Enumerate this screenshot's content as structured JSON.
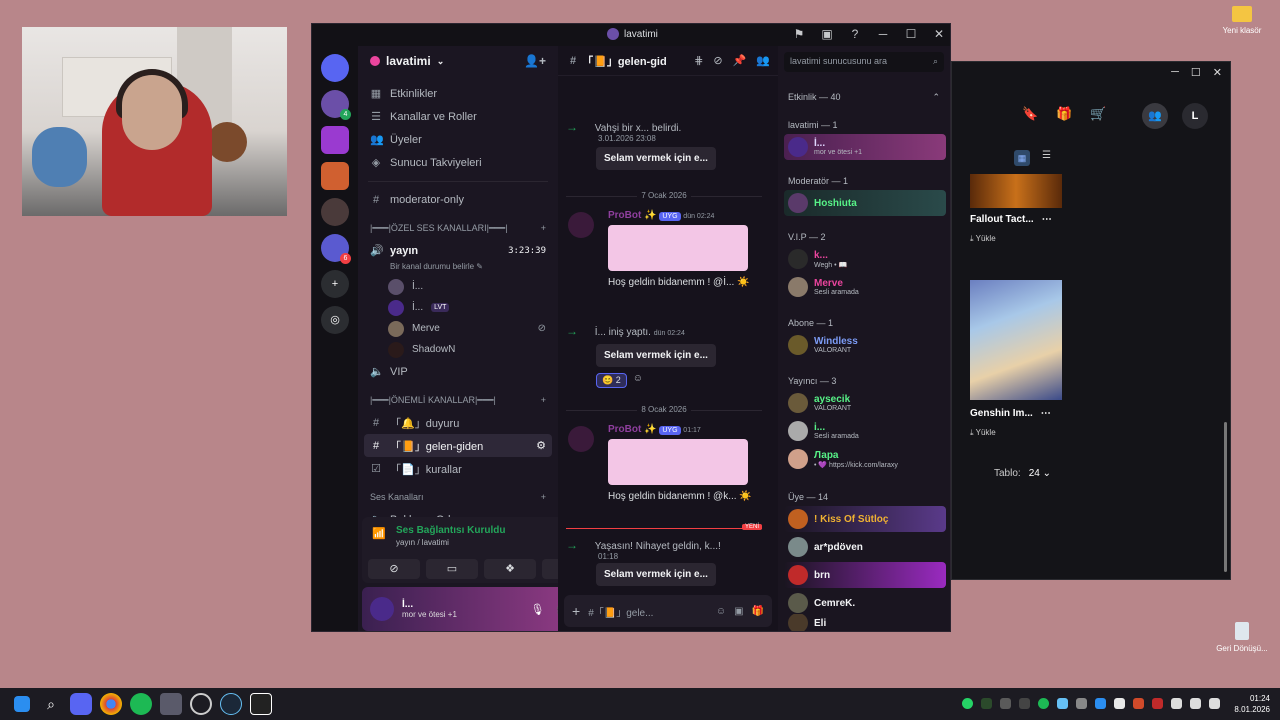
{
  "desktop": {
    "folder_label": "Yeni klasör",
    "recycle_label": "Geri Dönüşü..."
  },
  "discord": {
    "window_title": "lavatimi",
    "guild_name": "lavatimi",
    "nav": [
      {
        "icon": "calendar-icon",
        "label": "Etkinlikler"
      },
      {
        "icon": "channels-roles-icon",
        "label": "Kanallar ve Roller"
      },
      {
        "icon": "members-icon",
        "label": "Üyeler"
      },
      {
        "icon": "boost-icon",
        "label": "Sunucu Takviyeleri"
      }
    ],
    "moderator_channel": "moderator-only",
    "voice_category": "|━━━|ÖZEL SES KANALLARI|━━━|",
    "voice_channel": "yayın",
    "voice_timer": "3:23:39",
    "voice_status": "Bir kanal durumu belirle",
    "voice_users": [
      {
        "name": "İ..."
      },
      {
        "name": "İ...",
        "tag": "LVT"
      },
      {
        "name": "Merve"
      },
      {
        "name": "ShadowN"
      }
    ],
    "vip_channel": "VIP",
    "important_category": "|━━━|ÖNEMLİ KANALLAR|━━━|",
    "text_channels": [
      {
        "label": "「🔔」duyuru",
        "selected": false
      },
      {
        "label": "「📙」gelen-giden",
        "selected": true
      },
      {
        "label": "「📄」kurallar",
        "selected": false
      }
    ],
    "voice_channels_cat": "Ses Kanalları",
    "waiting_room": "Bekleme Odası",
    "voice_panel": {
      "title": "Ses Bağlantısı Kuruldu",
      "sub": "yayın / lavatimi"
    },
    "user_panel": {
      "name": "İ...",
      "status": "mor ve ötesi +1"
    },
    "chat": {
      "channel": "「📙」gelen-gid",
      "msg1": {
        "text": "Vahşi bir x... belirdi.",
        "time": "3.01.2026 23:08",
        "btn": "Selam vermek için e..."
      },
      "date1": "7 Ocak 2026",
      "bot_name": "ProBot ✨",
      "bot_tag": "UYG",
      "bot_time1": "dün 02:24",
      "welcome1": "Hoş geldin bidanemm ! @İ... ☀️",
      "msg2": {
        "text": "İ... iniş yaptı.",
        "time": "dün 02:24",
        "btn": "Selam vermek için e..."
      },
      "reaction_count": "2",
      "date2": "8 Ocak 2026",
      "bot_time2": "01:17",
      "welcome2": "Hoş geldin bidanemm ! @k... ☀️",
      "new_label": "YENİ",
      "msg3": {
        "text": "Yaşasın! Nihayet geldin, k...!",
        "time": "01:18",
        "btn": "Selam vermek için e..."
      },
      "composer_placeholder": "#「📙」gele..."
    },
    "member_search": "lavatimi sunucusunu ara",
    "activity_header": "Etkinlik — 40",
    "groups": [
      {
        "title": "lavatimi — 1",
        "members": [
          {
            "name": "İ...",
            "status": "mor ve ötesi +1",
            "color": "#e0d6ff"
          }
        ]
      },
      {
        "title": "Moderatör — 1",
        "members": [
          {
            "name": "Hoshiuta",
            "status": "",
            "color": "#57f287"
          }
        ]
      },
      {
        "title": "V.I.P — 2",
        "members": [
          {
            "name": "k...",
            "status": "Wegh • 📖",
            "color": "#eb459e"
          },
          {
            "name": "Merve",
            "status": "Sesli aramada",
            "color": "#eb459e"
          }
        ]
      },
      {
        "title": "Abone — 1",
        "members": [
          {
            "name": "Windless",
            "status": "VALORANT",
            "color": "#7c9cf5"
          }
        ]
      },
      {
        "title": "Yayıncı — 3",
        "members": [
          {
            "name": "aysecik",
            "status": "VALORANT",
            "color": "#57f287"
          },
          {
            "name": "i...",
            "status": "Sesli aramada",
            "color": "#57f287"
          },
          {
            "name": "Лара",
            "status": "• 💜 https://kick.com/laraxy",
            "color": "#57f287"
          }
        ]
      },
      {
        "title": "Üye — 14",
        "members": [
          {
            "name": "! Kiss Of Sütloç",
            "status": "",
            "color": "#f0b232"
          },
          {
            "name": "ar*pdöven",
            "status": "",
            "color": "#f2f3f5"
          },
          {
            "name": "brn",
            "status": "",
            "color": "#f2f3f5"
          },
          {
            "name": "CemreK.",
            "status": "",
            "color": "#f2f3f5"
          },
          {
            "name": "Eli",
            "status": "",
            "color": "#f2f3f5"
          }
        ]
      }
    ]
  },
  "second_window": {
    "game1": "Fallout Tact...",
    "game1_action": "Yükle",
    "game2": "Genshin Im...",
    "game2_action": "Yükle",
    "avatar_letter": "L",
    "table_label": "Tablo:",
    "table_value": "24"
  },
  "taskbar": {
    "time": "01:24",
    "date": "8.01.2026"
  }
}
